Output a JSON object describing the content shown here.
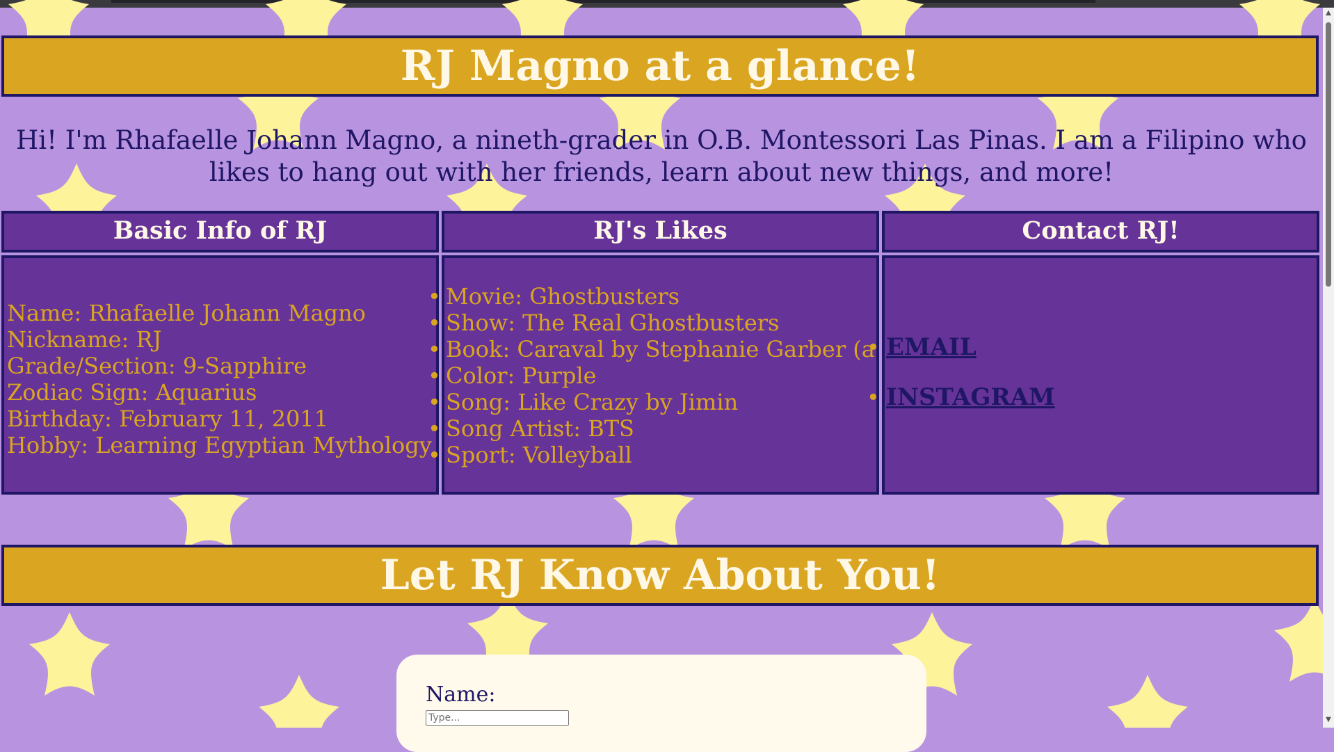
{
  "header": {
    "title": "RJ Magno at a glance!"
  },
  "intro": {
    "text": "Hi! I'm Rhafaelle Johann Magno, a nineth-grader in O.B. Montessori Las Pinas. I am a Filipino who likes to hang out with her friends, learn about new things, and more!"
  },
  "basic_info": {
    "heading": "Basic Info of RJ",
    "items": [
      "Name: Rhafaelle Johann Magno",
      "Nickname: RJ",
      "Grade/Section: 9-Sapphire",
      "Zodiac Sign: Aquarius",
      "Birthday: February 11, 2011",
      "Hobby: Learning Egyptian Mythology"
    ]
  },
  "likes": {
    "heading": "RJ's Likes",
    "items": [
      "Movie: Ghostbusters",
      "Show: The Real Ghostbusters",
      "Book: Caraval by Stephanie Garber (a series)",
      "Color: Purple",
      "Song: Like Crazy by Jimin",
      "Song Artist: BTS",
      "Sport: Volleyball"
    ]
  },
  "contact": {
    "heading": "Contact RJ!",
    "links": [
      "EMAIL",
      "INSTAGRAM"
    ]
  },
  "section2": {
    "title": "Let RJ Know About You!"
  },
  "form": {
    "name_label": "Name:",
    "name_placeholder": "Type..."
  },
  "colors": {
    "background": "#b893e0",
    "star": "#fdf39a",
    "gold": "#daa520",
    "purple_box": "#663399",
    "navy": "#1f1765",
    "cream": "#fff8e7"
  }
}
